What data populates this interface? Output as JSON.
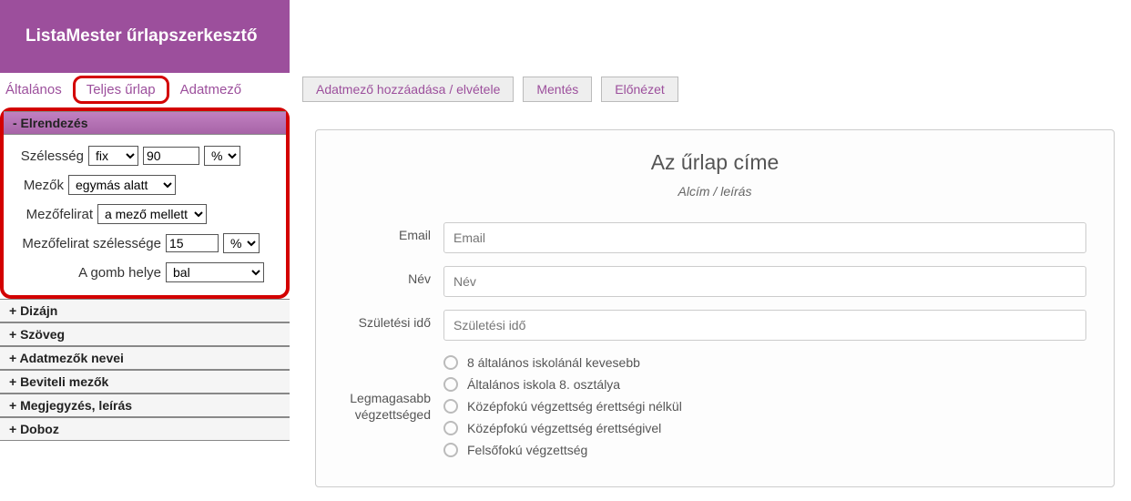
{
  "header": {
    "title": "ListaMester űrlapszerkesztő"
  },
  "tabs": [
    {
      "label": "Általános",
      "active": false
    },
    {
      "label": "Teljes űrlap",
      "active": true
    },
    {
      "label": "Adatmező",
      "active": false
    }
  ],
  "toolbar": [
    {
      "label": "Adatmező hozzáadása / elvétele"
    },
    {
      "label": "Mentés"
    },
    {
      "label": "Előnézet"
    }
  ],
  "sections": {
    "layout": {
      "title": "- Elrendezés",
      "width_label": "Szélesség",
      "width_mode": "fix",
      "width_value": "90",
      "width_unit": "%",
      "fields_label": "Mezők",
      "fields_value": "egymás alatt",
      "fieldlabel_label": "Mezőfelirat",
      "fieldlabel_value": "a mező mellett",
      "labelwidth_label": "Mezőfelirat szélessége",
      "labelwidth_value": "15",
      "labelwidth_unit": "%",
      "buttonpos_label": "A gomb helye",
      "buttonpos_value": "bal"
    },
    "collapsed": [
      "+ Dizájn",
      "+ Szöveg",
      "+ Adatmezők nevei",
      "+ Beviteli mezők",
      "+ Megjegyzés, leírás",
      "+ Doboz"
    ]
  },
  "preview": {
    "title": "Az űrlap címe",
    "subtitle": "Alcím / leírás",
    "fields": {
      "email": {
        "label": "Email",
        "placeholder": "Email"
      },
      "name": {
        "label": "Név",
        "placeholder": "Név"
      },
      "birth": {
        "label": "Születési idő",
        "placeholder": "Születési idő"
      },
      "education": {
        "label": "Legmagasabb végzettséged",
        "options": [
          "8 általános iskolánál kevesebb",
          "Általános iskola 8. osztálya",
          "Középfokú végzettség érettségi nélkül",
          "Középfokú végzettség érettségivel",
          "Felsőfokú végzettség"
        ]
      }
    }
  }
}
